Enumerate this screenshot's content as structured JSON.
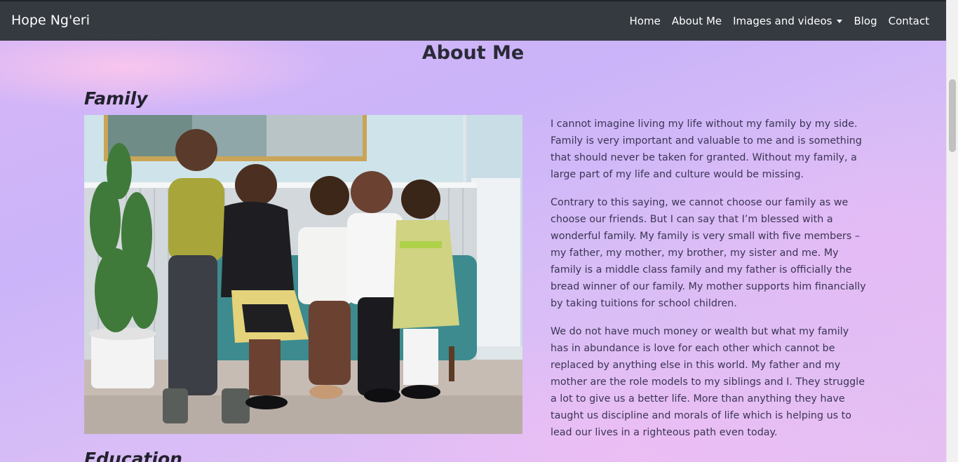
{
  "navbar": {
    "brand": "Hope Ng'eri",
    "links": [
      {
        "label": "Home"
      },
      {
        "label": "About Me"
      },
      {
        "label": "Images and videos"
      },
      {
        "label": "Blog"
      },
      {
        "label": "Contact"
      }
    ]
  },
  "main": {
    "title": "About Me",
    "family": {
      "heading": "Family",
      "paragraphs": [
        "I cannot imagine living my life without my family by my side. Family is very important and valuable to me and is something that should never be taken for granted. Without my family, a large part of my life and culture would be missing.",
        "Contrary to this saying, we cannot choose our family as we choose our friends. But I can say that I’m blessed with a wonderful family. My family is very small with five members – my father, my mother, my brother, my sister and me. My family is a middle class family and my father is officially the bread winner of our family. My mother supports him financially by taking tuitions for school children.",
        "We do not have much money or wealth but what my family has in abundance is love for each other which cannot be replaced by anything else in this world. My father and my mother are the role models to my siblings and I. They struggle a lot to give us a better life. More than anything they have taught us discipline and morals of life which is helping us to lead our lives in a righteous path even today."
      ]
    },
    "education": {
      "heading": "Education"
    }
  },
  "colors": {
    "navbar_bg": "#343a40",
    "text": "#3b3555",
    "heading": "#2a2a36"
  }
}
